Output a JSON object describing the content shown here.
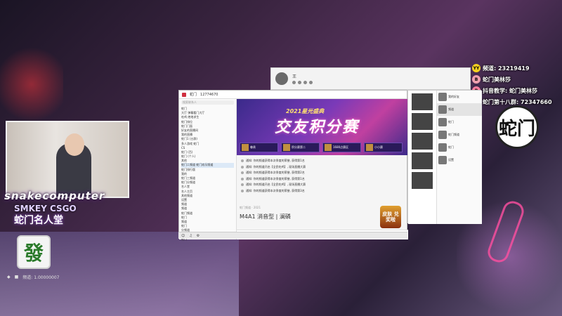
{
  "overlay": {
    "brand": "snakecomputer",
    "subtitle": "SMKEY CSGO",
    "slogan": "蛇门名人堂",
    "mahjong_tile": "發",
    "list": [
      {
        "badge": "YY",
        "text": "频道: 23219419",
        "color": "#f5d020"
      },
      {
        "badge": "B",
        "text": "蛇门美林莎",
        "color": "#f0a0b0"
      },
      {
        "badge": "B",
        "text": "抖音教学: 蛇门美林莎",
        "color": "#ff80a0"
      },
      {
        "badge": "Q",
        "text": "蛇门第十八群: 72347660",
        "color": "#f0c020"
      }
    ],
    "logo": "蛇门"
  },
  "taskbar": {
    "items": [
      "◆",
      "■",
      "频道: 1.00000007"
    ]
  },
  "profile": {
    "name": "王"
  },
  "qq": {
    "title": "蛇门",
    "tab_count": "12774670",
    "search_placeholder": "搜索联系人",
    "tree": [
      "蛇门",
      "大厅 弹幕看门大厅",
      "吃鸡 绝地求生",
      "蛇门排位",
      "蛇门门面",
      "好友的直播间",
      "我的直播",
      "蛇门1 (五群)",
      "多人游戏 蛇门",
      "CS",
      "蛇门 (百)",
      "蛇门 (个人)",
      "其他",
      "蛇门二频道  蛇门欢乐频道",
      "蛇门排行版",
      "我的",
      "蛇门三频道",
      "蛇门分频道",
      "名人堂",
      "名人主页",
      "其他频道",
      "设置",
      "频道",
      "频道",
      "蛇门频道",
      "蛇门",
      "频道",
      "蛇门",
      "分频道",
      "蛇门",
      "蛇门"
    ],
    "banner": {
      "title_small": "2021星光盛典",
      "title_big": "交友积分赛",
      "tiles": [
        "尊贵",
        "积分赛第二",
        "1680点赛区",
        "小小赛"
      ]
    },
    "messages": [
      "通知: 你的频道获得本次季度的荣誉, 获得第1名",
      "通知: 你的频道开启【全民吃鸡】, 现场直播大赛",
      "通知: 你的频道获得本次季度的荣誉, 获得第2名",
      "通知: 你的频道获得本次季度的荣誉, 获得第1名",
      "通知: 你的频道开启【全民吃鸡】, 现场直播大赛",
      "通知: 你的频道获得本次季度的荣誉, 获得第3名"
    ],
    "chat_meta": "蛇门频道 · 2021",
    "chat_title": "M4A1 消音型 | 澜磷",
    "promo": "皮肤 兑奖啦"
  },
  "contacts": {
    "items": [
      {
        "label": "我的好友"
      },
      {
        "label": "频道"
      },
      {
        "label": "蛇门"
      },
      {
        "label": "蛇门频道"
      },
      {
        "label": "蛇门"
      },
      {
        "label": "设置"
      }
    ]
  }
}
